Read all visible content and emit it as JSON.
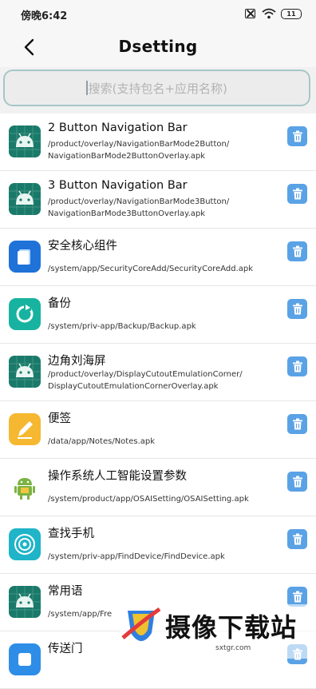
{
  "status_bar": {
    "time": "傍晚6:42",
    "battery": "11"
  },
  "header": {
    "back_icon": "chevron-left-icon",
    "title": "Dsetting"
  },
  "search": {
    "placeholder": "搜索(支持包名+应用名称)"
  },
  "apps": [
    {
      "name": "2 Button Navigation Bar",
      "path": "/product/overlay/NavigationBarMode2Button/\nNavigationBarMode2ButtonOverlay.apk",
      "icon": "android-icon",
      "color": "#1a7a6a"
    },
    {
      "name": "3 Button Navigation Bar",
      "path": "/product/overlay/NavigationBarMode3Button/\nNavigationBarMode3ButtonOverlay.apk",
      "icon": "android-icon",
      "color": "#1a7a6a"
    },
    {
      "name": "安全核心组件",
      "path": "/system/app/SecurityCoreAdd/SecurityCoreAdd.apk",
      "icon": "security-core-icon",
      "color": "#1f72d8"
    },
    {
      "name": "备份",
      "path": "/system/priv-app/Backup/Backup.apk",
      "icon": "backup-icon",
      "color": "#18b3a0"
    },
    {
      "name": "边角刘海屏",
      "path": "/product/overlay/DisplayCutoutEmulationCorner/\nDisplayCutoutEmulationCornerOverlay.apk",
      "icon": "android-icon",
      "color": "#1a7a6a"
    },
    {
      "name": "便签",
      "path": "/data/app/Notes/Notes.apk",
      "icon": "notes-icon",
      "color": "#f6b830"
    },
    {
      "name": "操作系统人工智能设置参数",
      "path": "/system/product/app/OSAISetting/OSAISetting.apk",
      "icon": "android-robot-icon",
      "color": "#7cb342"
    },
    {
      "name": "查找手机",
      "path": "/system/priv-app/FindDevice/FindDevice.apk",
      "icon": "find-device-icon",
      "color": "#1fb4c8"
    },
    {
      "name": "常用语",
      "path": "/system/app/Fre",
      "icon": "android-icon",
      "color": "#1a7a6a"
    },
    {
      "name": "传送门",
      "path": "",
      "icon": "portal-icon",
      "color": "#2e8de6"
    }
  ],
  "delete_icon": "trash-icon",
  "accent_color": "#5aa2e6",
  "watermark": {
    "text": "摄像下载站",
    "url": "sxtgr.com"
  }
}
